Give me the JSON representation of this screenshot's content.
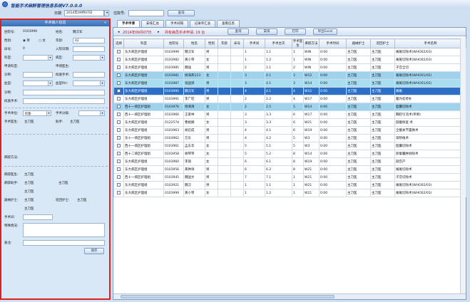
{
  "window": {
    "title": "智能手术麻醉管理信息系统V7.0.0.0"
  },
  "topbar": {
    "date_label": "日期",
    "date_value": "2014年09月07日",
    "patient_no_label": "住院号:",
    "patient_no_value": "",
    "query_button": "查询"
  },
  "left_panel": {
    "header": "手术病人信息",
    "collapse": "«",
    "fields": {
      "hosp_no_label": "住院号:",
      "hosp_no_value": "0103999",
      "name_label": "姓名:",
      "name_value": "魏汉军",
      "gender_label": "性别:",
      "gender_male": "男",
      "gender_female": "女",
      "age_label": "年龄:",
      "age_value": "42",
      "bed_label": "床号:",
      "bed_value": "0",
      "dept_label": "科室:",
      "dept_value": "",
      "ward_label": "病区:",
      "adm_label": "入院日期:",
      "adm_value": "",
      "apply_dept_label": "申请科室:",
      "apply_dept_value": "",
      "apply_doc_label": "申请医生:",
      "apply_doc_value": "",
      "diag_label": "诊断:",
      "diag_value": "",
      "op_label": "拟施手术:",
      "op_value": "",
      "blood_label": "血型:",
      "blood_value": "",
      "rh_label": "血型RH:",
      "rh_value": "",
      "position_label": "手术体位:",
      "position_value": "仰卧",
      "op_name_label": "手术名称:",
      "op_name_value": "",
      "op_level_label": "手术分级:",
      "op_level_value": "",
      "surgeon_label": "手术医生:",
      "surgeon_value": "主刀医",
      "asst_label": "助手:",
      "asst_value": "",
      "anes_method_label": "麻醉方法:",
      "anes_method_value": "",
      "anes_doc_label": "麻醉医生:",
      "anes_doc_value": "主刀医",
      "anes_asst_label": "麻醉助手:",
      "anes_asst_value": "主刀医",
      "wash_nurse_label": "器械护士:",
      "wash_nurse_value": "主刀医",
      "circ_nurse_label": "巡回护士:",
      "circ_nurse_value": "主刀医",
      "room_label": "手术间:",
      "room_value": "",
      "remark_label": "备注:",
      "remark_value": "",
      "special_label": "特殊情况:",
      "special_value": ""
    },
    "save_button": "保存"
  },
  "tabs": [
    "手术申请",
    "安排汇总",
    "手术间隔",
    "记录单汇总",
    "查看信息"
  ],
  "toolbar": {
    "date": "2014年09月07日",
    "count_text": "共有病员手术申请: 19 台",
    "btn_query": "查询",
    "btn_print": "打印",
    "btn_arrange": "安排",
    "btn_export": "导出Excel"
  },
  "grid": {
    "columns": [
      "选择",
      "科室",
      "住院号",
      "姓名",
      "性别",
      "年龄",
      "床号",
      "手术间",
      "手术台次",
      "手术医生",
      "麻醉方法",
      "手术时间",
      "器械护士",
      "巡回护士",
      "手术名称"
    ],
    "rows": [
      {
        "style": "",
        "cells": [
          "",
          "东大病区护理组",
          "0103999",
          "魏汉军",
          "男",
          "",
          "",
          "1",
          "1.1",
          "1",
          "WIN",
          "0:00",
          "主刀医",
          "主刀医",
          "阑尾切除术(WHO02/03)"
        ]
      },
      {
        "style": "",
        "cells": [
          "",
          "东大病区护理组",
          "0103982",
          "黄小琴",
          "女",
          "",
          "",
          "1",
          "1.2",
          "1",
          "WIN",
          "0:00",
          "主刀医",
          "主刀医",
          "阑尾切除术(WHO02/03)"
        ]
      },
      {
        "style": "",
        "cells": [
          "",
          "东大病区护理组",
          "0103985",
          "魏强",
          "男",
          "",
          "",
          "2",
          "1.1",
          "2",
          "WIN",
          "0:00",
          "主刀医",
          "主刀医",
          "子宫全切"
        ]
      },
      {
        "style": "hl",
        "cells": [
          "",
          "东大病区护理组",
          "0103981",
          "杨海燕123",
          "女",
          "",
          "",
          "3",
          "0.1",
          "3",
          "W12",
          "0:00",
          "主刀医",
          "主刀医",
          "阑尾切除术(WHO01/02)"
        ]
      },
      {
        "style": "hl2",
        "cells": [
          "",
          "东大病区护理组",
          "0103987",
          "张国梁",
          "男",
          "",
          "",
          "3",
          "4.1",
          "3",
          "W14",
          "0:00",
          "主刀医",
          "主刀医",
          "阑尾切除术(WHO01/02)"
        ]
      },
      {
        "style": "sel",
        "cells": [
          "",
          "东大病区护理组",
          "0103990",
          "魏汉军",
          "男",
          "",
          "",
          "4",
          "4.1",
          "4",
          "W12",
          "0:00",
          "主刀医",
          "主刀医",
          "阑尾"
        ]
      },
      {
        "style": "",
        "cells": [
          "",
          "东大病区护理组",
          "0103991",
          "李广旺",
          "男",
          "",
          "",
          "2",
          "2.2",
          "4",
          "W17",
          "0:00",
          "主刀医",
          "主刀医",
          "腹外疝修补"
        ]
      },
      {
        "style": "hl",
        "cells": [
          "",
          "西十一病区护理组",
          "0103976",
          "杨清清",
          "女",
          "",
          "",
          "2",
          "2.5",
          "5",
          "W14",
          "0:00",
          "主刀医",
          "主刀医",
          "胆囊切除术"
        ]
      },
      {
        "style": "",
        "cells": [
          "",
          "西十一病区护理组",
          "0103966",
          "王家林",
          "男",
          "",
          "",
          "3",
          "3.3",
          "6",
          "W17",
          "0:00",
          "主刀医",
          "主刀医",
          "胸腔引流术(单侧)"
        ]
      },
      {
        "style": "",
        "cells": [
          "",
          "东大病区护理组",
          "0122574",
          "曹妮娜",
          "女",
          "",
          "",
          "3",
          "3.3",
          "6",
          "W21",
          "0:00",
          "主刀医",
          "主刀医",
          "剖腹探查 术"
        ]
      },
      {
        "style": "",
        "cells": [
          "",
          "东大病区护理组",
          "0103963",
          "胡忍成",
          "男",
          "",
          "",
          "4",
          "4.1",
          "6",
          "W19",
          "0:00",
          "主刀医",
          "主刀医",
          "全髋关节置换术"
        ]
      },
      {
        "style": "",
        "cells": [
          "",
          "东十一病区护理组",
          "0103962",
          "方东",
          "男",
          "",
          "",
          "4",
          "4.2",
          "5",
          "W3",
          "0:00",
          "主刀医",
          "主刀医",
          "肾移植术"
        ]
      },
      {
        "style": "",
        "cells": [
          "",
          "西十一病区护理组",
          "0103961",
          "孟东华",
          "女",
          "",
          "",
          "5",
          "5.1",
          "5",
          "W3",
          "0:00",
          "主刀医",
          "主刀医",
          "胆囊切除术"
        ]
      },
      {
        "style": "",
        "cells": [
          "",
          "西十二病区护理组",
          "0103958",
          "胡琴琴",
          "女",
          "",
          "",
          "5",
          "5.2",
          "8",
          "W14",
          "0:00",
          "主刀医",
          "主刀医",
          "卵巢囊肿剥除术"
        ]
      },
      {
        "style": "",
        "cells": [
          "",
          "东大病区护理组",
          "0103960",
          "李丽",
          "女",
          "",
          "",
          "6",
          "6.1",
          "8",
          "W19",
          "0:00",
          "主刀医",
          "主刀医",
          "剖宫产"
        ]
      },
      {
        "style": "",
        "cells": [
          "",
          "东大病区护理组",
          "0103956",
          "黄钟祥",
          "男",
          "",
          "",
          "6",
          "6.2",
          "8",
          "W21",
          "0:00",
          "主刀医",
          "主刀医",
          "阑尾切除术"
        ]
      },
      {
        "style": "",
        "cells": [
          "",
          "西十一病区护理组",
          "0103945",
          "魏国文",
          "男",
          "",
          "",
          "7",
          "7.1",
          "1",
          "W21",
          "0:00",
          "主刀医",
          "主刀医",
          "子宫切除术"
        ]
      },
      {
        "style": "",
        "cells": [
          "",
          "东大病区护理组",
          "0103921",
          "魏汉",
          "男",
          "",
          "",
          "1",
          "1.1",
          "1",
          "W21",
          "0:00",
          "主刀医",
          "主刀医",
          "阑尾切除术(WHO02/03)"
        ]
      },
      {
        "style": "",
        "cells": [
          "",
          "东大病区护理组",
          "0103999",
          "黄小琴",
          "女",
          "",
          "",
          "1",
          "1.2",
          "1",
          "W21",
          "0:00",
          "主刀医",
          "主刀医",
          "阑尾切除术(WHO02/03)"
        ]
      }
    ]
  }
}
